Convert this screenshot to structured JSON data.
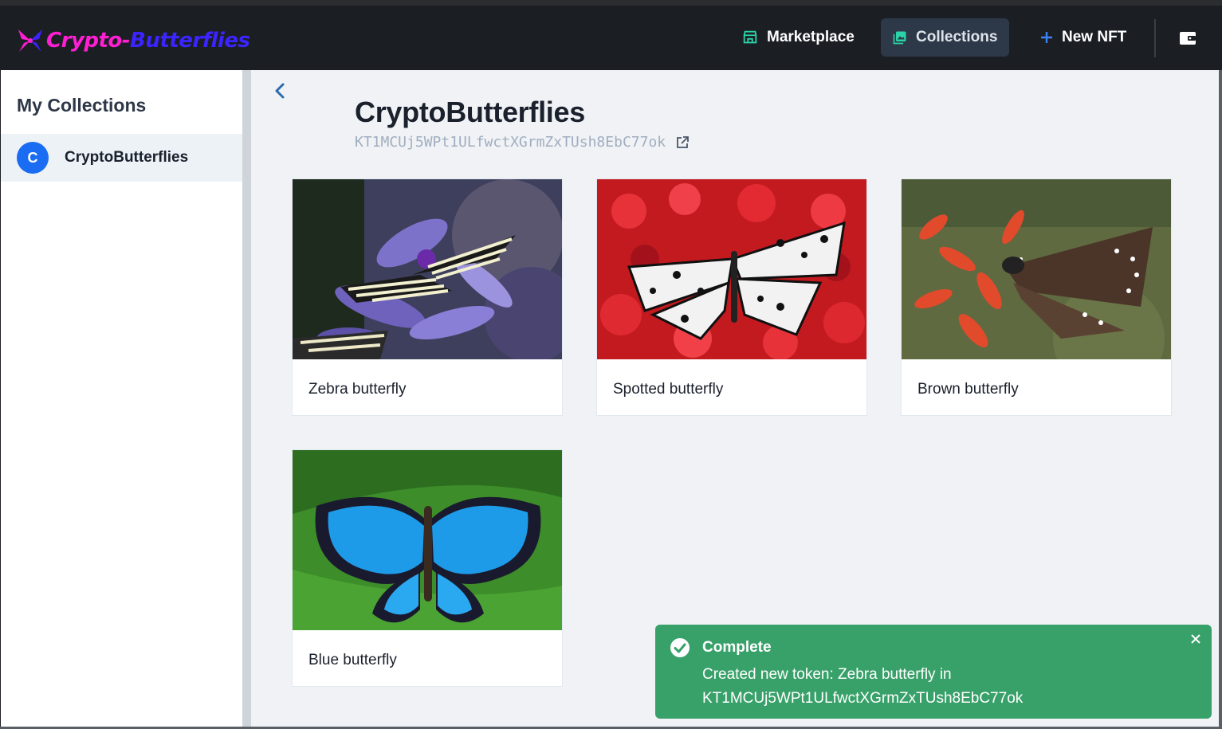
{
  "brand": {
    "part1": "Crypto-",
    "part2": "Butterflies",
    "colors": {
      "primary": "#ff1ed2",
      "secondary": "#3b24ff"
    }
  },
  "nav": {
    "marketplace": "Marketplace",
    "collections": "Collections",
    "new_nft": "New NFT",
    "icons": {
      "marketplace": "store-icon",
      "collections": "gallery-icon",
      "new_nft": "plus-icon",
      "wallet": "wallet-icon"
    }
  },
  "sidebar": {
    "title": "My Collections",
    "items": [
      {
        "avatar": "C",
        "label": "CryptoButterflies",
        "selected": true
      }
    ]
  },
  "collection": {
    "title": "CryptoButterflies",
    "address": "KT1MCUj5WPt1ULfwctXGrmZxTUsh8EbC77ok",
    "address_icon": "external-link-icon",
    "tokens": [
      {
        "name": "Zebra butterfly"
      },
      {
        "name": "Spotted butterfly"
      },
      {
        "name": "Brown butterfly"
      },
      {
        "name": "Blue butterfly"
      }
    ]
  },
  "toast": {
    "title": "Complete",
    "message": "Created new token: Zebra butterfly in KT1MCUj5WPt1ULfwctXGrmZxTUsh8EbC77ok",
    "color": "#38a169"
  },
  "colors": {
    "accent": "#1a6cf2",
    "nav_bg": "#1b1f24"
  }
}
